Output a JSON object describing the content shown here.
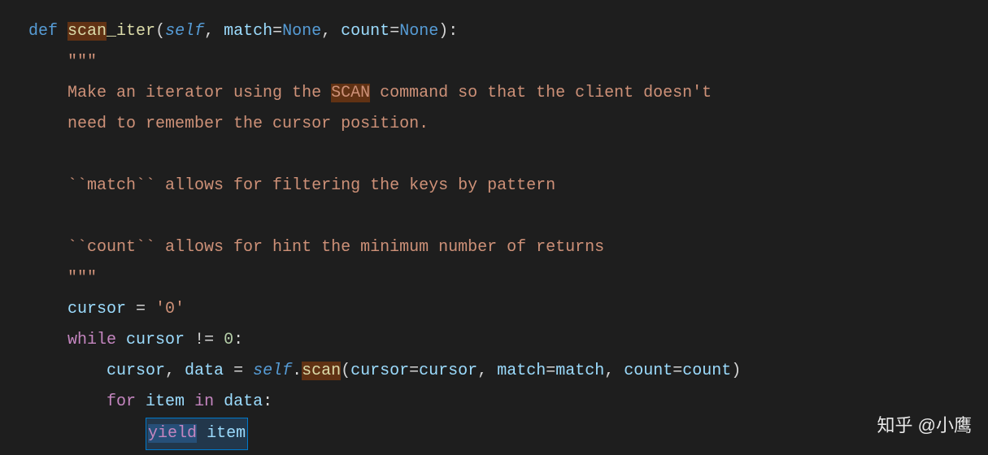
{
  "code": {
    "def_kw": "def",
    "fn_name_hl": "scan",
    "fn_name_rest": "_iter",
    "self_param": "self",
    "match_param": "match",
    "none1": "None",
    "count_param": "count",
    "none2": "None",
    "triple_quote_open": "\"\"\"",
    "doc_line1_pre": "Make an iterator using the ",
    "doc_scan_hl": "SCAN",
    "doc_line1_post": " command so that the client doesn't",
    "doc_line2": "need to remember the cursor position.",
    "doc_line3": "``match`` allows for filtering the keys by pattern",
    "doc_line4": "``count`` allows for hint the minimum number of returns",
    "triple_quote_close": "\"\"\"",
    "cursor_var": "cursor",
    "zero_str": "'0'",
    "while_kw": "while",
    "cursor_var2": "cursor",
    "zero_num": "0",
    "cursor_var3": "cursor",
    "data_var": "data",
    "self_var": "self",
    "scan_call": "scan",
    "cursor_kw": "cursor",
    "cursor_arg": "cursor",
    "match_kw": "match",
    "match_arg": "match",
    "count_kw": "count",
    "count_arg": "count",
    "for_kw": "for",
    "item_var": "item",
    "in_kw": "in",
    "data_var2": "data",
    "yield_kw": "yield",
    "item_var2": "item"
  },
  "watermark": "知乎 @小鹰"
}
